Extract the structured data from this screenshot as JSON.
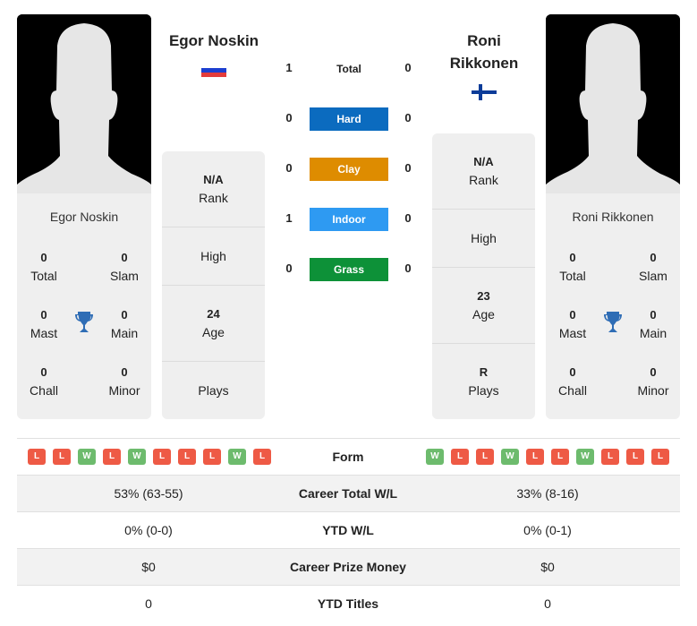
{
  "player1": {
    "name": "Egor Noskin",
    "flag": "russia-flag",
    "card": {
      "name": "Egor Noskin",
      "total": {
        "value": "0",
        "label": "Total"
      },
      "slam": {
        "value": "0",
        "label": "Slam"
      },
      "mast": {
        "value": "0",
        "label": "Mast"
      },
      "main": {
        "value": "0",
        "label": "Main"
      },
      "chall": {
        "value": "0",
        "label": "Chall"
      },
      "minor": {
        "value": "0",
        "label": "Minor"
      }
    },
    "info": {
      "rank": {
        "value": "N/A",
        "label": "Rank"
      },
      "high": {
        "value": "",
        "label": "High"
      },
      "age": {
        "value": "24",
        "label": "Age"
      },
      "plays": {
        "value": "",
        "label": "Plays"
      }
    },
    "form": [
      "L",
      "L",
      "W",
      "L",
      "W",
      "L",
      "L",
      "L",
      "W",
      "L"
    ]
  },
  "player2": {
    "name": "Roni Rikkonen",
    "name_line1": "Roni",
    "name_line2": "Rikkonen",
    "flag": "finland-flag",
    "card": {
      "name": "Roni Rikkonen",
      "total": {
        "value": "0",
        "label": "Total"
      },
      "slam": {
        "value": "0",
        "label": "Slam"
      },
      "mast": {
        "value": "0",
        "label": "Mast"
      },
      "main": {
        "value": "0",
        "label": "Main"
      },
      "chall": {
        "value": "0",
        "label": "Chall"
      },
      "minor": {
        "value": "0",
        "label": "Minor"
      }
    },
    "info": {
      "rank": {
        "value": "N/A",
        "label": "Rank"
      },
      "high": {
        "value": "",
        "label": "High"
      },
      "age": {
        "value": "23",
        "label": "Age"
      },
      "plays": {
        "value": "R",
        "label": "Plays"
      }
    },
    "form": [
      "W",
      "L",
      "L",
      "W",
      "L",
      "L",
      "W",
      "L",
      "L",
      "L"
    ]
  },
  "h2h": {
    "total": {
      "label": "Total",
      "p1": "1",
      "p2": "0"
    },
    "surfaces": [
      {
        "label": "Hard",
        "p1": "0",
        "p2": "0",
        "color": "#0b6bbf"
      },
      {
        "label": "Clay",
        "p1": "0",
        "p2": "0",
        "color": "#de8c00"
      },
      {
        "label": "Indoor",
        "p1": "1",
        "p2": "0",
        "color": "#2e9af2"
      },
      {
        "label": "Grass",
        "p1": "0",
        "p2": "0",
        "color": "#0d9138"
      }
    ]
  },
  "table": {
    "form_label": "Form",
    "rows": [
      {
        "label": "Career Total W/L",
        "p1": "53% (63-55)",
        "p2": "33% (8-16)"
      },
      {
        "label": "YTD W/L",
        "p1": "0% (0-0)",
        "p2": "0% (0-1)"
      },
      {
        "label": "Career Prize Money",
        "p1": "$0",
        "p2": "$0"
      },
      {
        "label": "YTD Titles",
        "p1": "0",
        "p2": "0"
      }
    ]
  },
  "colors": {
    "win": "#6dbb6d",
    "loss": "#ee5a45",
    "trophy": "#2f6db5"
  }
}
